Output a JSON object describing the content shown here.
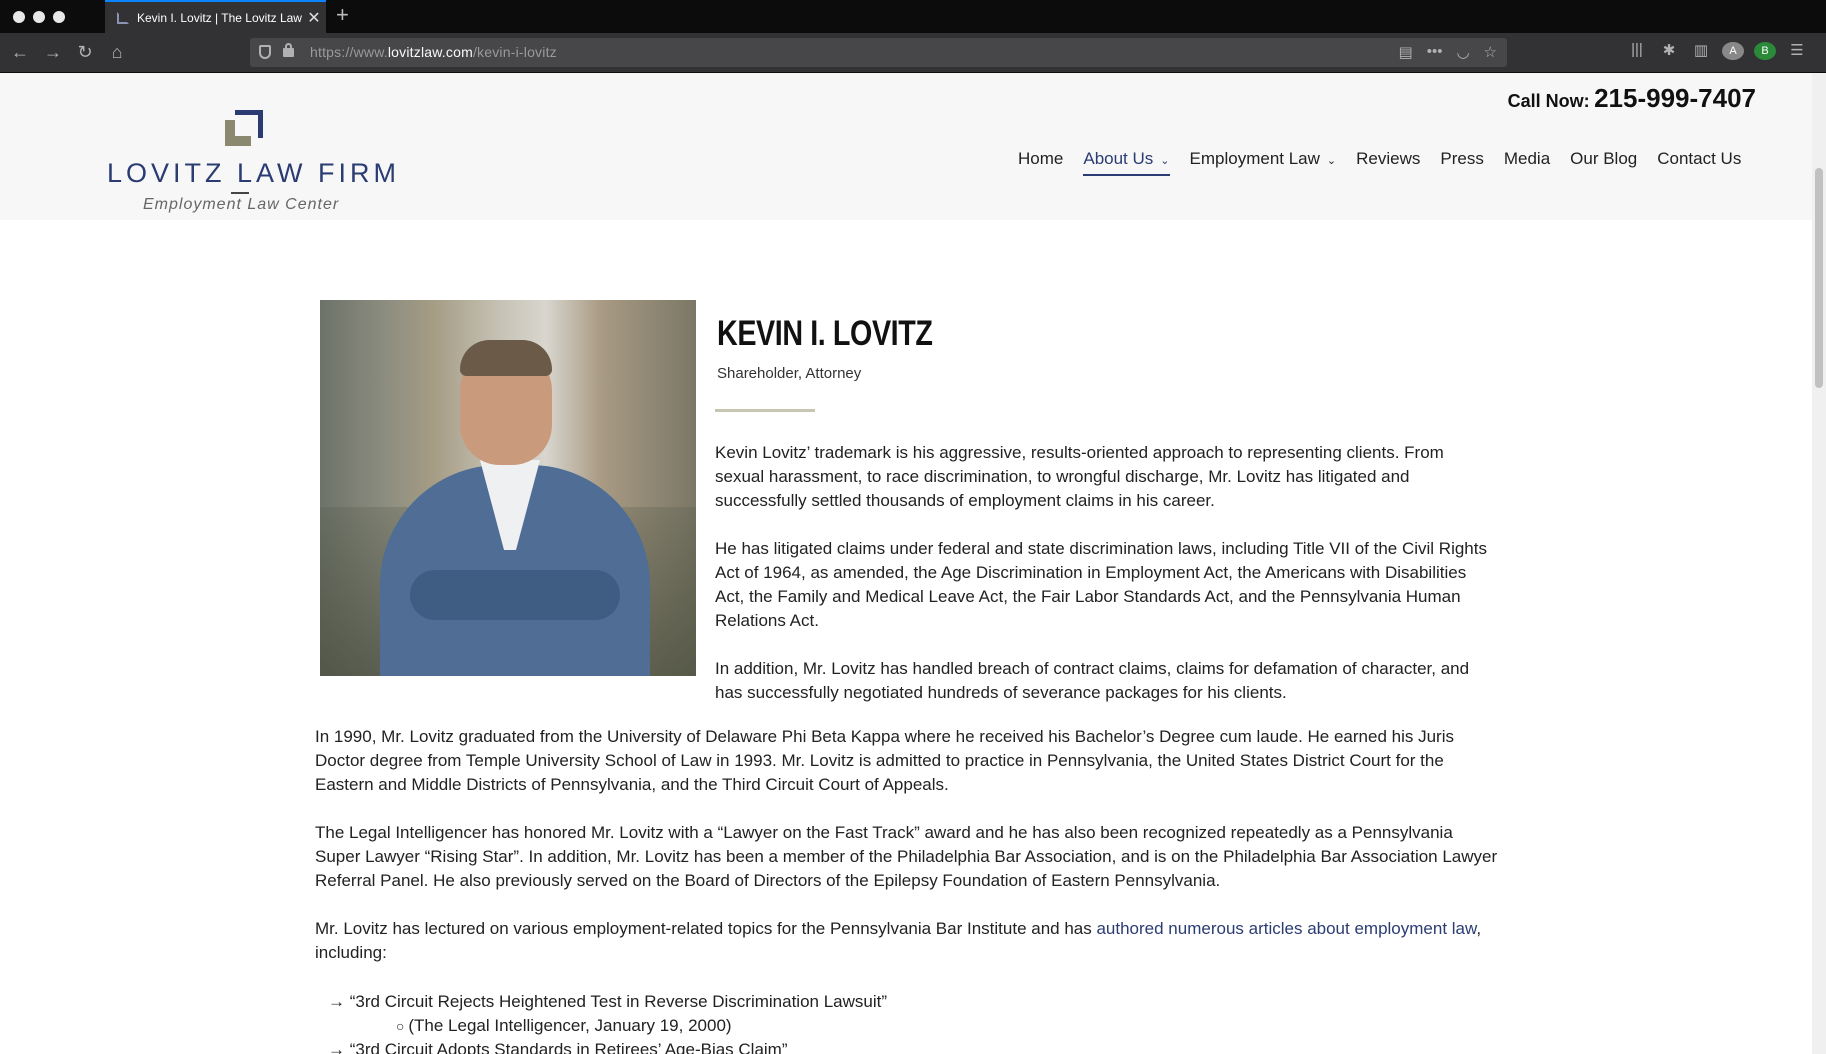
{
  "browser": {
    "tab_title": "Kevin I. Lovitz | The Lovitz Law",
    "url_prefix": "https://www.",
    "url_domain": "lovitzlaw.com",
    "url_path": "/kevin-i-lovitz",
    "profile_initial": "B"
  },
  "header": {
    "logo_name": "LOVITZ LAW FIRM",
    "logo_tagline": "Employment Law Center",
    "call_label": "Call Now:",
    "call_number": "215-999-7407",
    "nav": [
      {
        "label": "Home"
      },
      {
        "label": "About Us",
        "active": true,
        "dropdown": true
      },
      {
        "label": "Employment Law",
        "dropdown": true
      },
      {
        "label": "Reviews"
      },
      {
        "label": "Press"
      },
      {
        "label": "Media"
      },
      {
        "label": "Our Blog"
      },
      {
        "label": "Contact Us"
      }
    ]
  },
  "bio": {
    "name": "KEVIN I. LOVITZ",
    "role": "Shareholder, Attorney",
    "paragraphs_side": [
      "Kevin Lovitz’ trademark is his aggressive, results-oriented approach to representing clients. From sexual harassment, to race discrimination, to wrongful discharge, Mr. Lovitz has litigated and successfully settled thousands of employment claims in his career.",
      "He has litigated claims under federal and state discrimination laws, including Title VII of the Civil Rights Act of 1964, as amended, the Age Discrimination in Employment Act, the Americans with Disabilities Act, the Family and Medical Leave Act, the Fair Labor Standards Act, and the Pennsylvania Human Relations Act.",
      "In addition, Mr. Lovitz has handled breach of contract claims, claims for defamation of character, and has successfully negotiated hundreds of severance packages for his clients."
    ],
    "paragraphs_full": [
      "In 1990, Mr. Lovitz graduated from the University of Delaware Phi Beta Kappa where he received his Bachelor’s Degree cum laude. He earned his Juris Doctor degree from Temple University School of Law in 1993. Mr. Lovitz is admitted to practice in Pennsylvania, the United States District Court for the Eastern and Middle Districts of Pennsylvania, and the Third Circuit Court of Appeals.",
      "The Legal Intelligencer has honored Mr. Lovitz with a “Lawyer on the Fast Track” award and he has also been recognized repeatedly as a Pennsylvania Super Lawyer “Rising Star”. In addition, Mr. Lovitz has been a member of the Philadelphia Bar Association, and is on the Philadelphia Bar Association Lawyer Referral Panel. He also previously served on the Board of Directors of the Epilepsy Foundation of Eastern Pennsylvania."
    ],
    "lectures_before": "Mr. Lovitz has lectured on various employment-related topics for the Pennsylvania Bar Institute and has ",
    "lectures_link": "authored numerous articles about employment law",
    "lectures_after": ", including:",
    "articles": [
      {
        "title": "“3rd Circuit Rejects Heightened Test in Reverse Discrimination Lawsuit”",
        "source": "(The Legal Intelligencer, January 19, 2000)"
      },
      {
        "title": "“3rd Circuit Adopts Standards in Retirees’ Age-Bias Claim”",
        "source": ""
      }
    ]
  },
  "colors": {
    "brand_navy": "#2b3c73",
    "brand_olive": "#8b8870",
    "browser_dark": "#323234"
  }
}
